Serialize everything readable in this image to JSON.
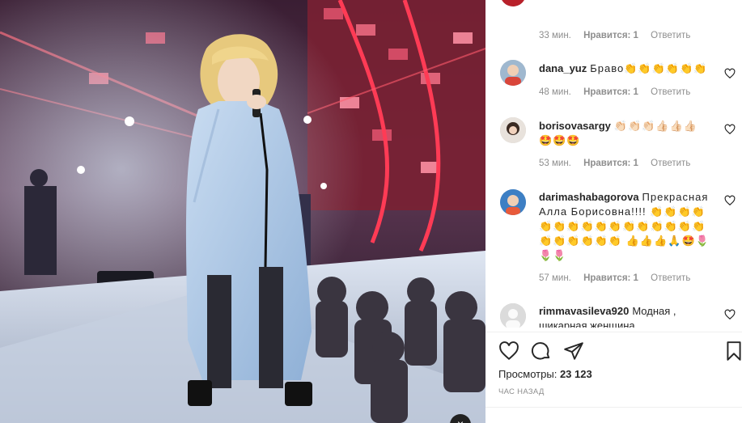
{
  "media": {
    "close_label": "×"
  },
  "comments": [
    {
      "id": "c0",
      "username": "",
      "text": "",
      "time": "33 мин.",
      "likes": "Нравится: 1",
      "reply": "Ответить"
    },
    {
      "id": "c1",
      "username": "dana_yuz",
      "text": "Браво👏👏👏👏👏👏",
      "time": "48 мин.",
      "likes": "Нравится: 1",
      "reply": "Ответить"
    },
    {
      "id": "c2",
      "username": "borisovasargy",
      "text": "👏🏻👏🏻👏🏻👍🏻👍🏻👍🏻 🤩🤩🤩",
      "time": "53 мин.",
      "likes": "Нравится: 1",
      "reply": "Ответить"
    },
    {
      "id": "c3",
      "username": "darimashabagorova",
      "text": "Прекрасная Алла Борисовна!!!! 👏👏👏👏👏👏👏👏👏👏👏👏👏👏👏👏👏👏👏👏👏👏 👍👍👍🙏🤩🌷🌷🌷",
      "time": "57 мин.",
      "likes": "Нравится: 1",
      "reply": "Ответить"
    },
    {
      "id": "c4",
      "username": "rimmavasileva920",
      "text": "Модная , шикарная женщина",
      "time": "",
      "likes": "",
      "reply": ""
    }
  ],
  "stats": {
    "views_label": "Просмотры:",
    "views_value": "23 123",
    "time_ago": "ЧАС НАЗАД"
  },
  "icons": {
    "like": "heart-icon",
    "comment": "comment-icon",
    "share": "share-icon",
    "save": "bookmark-icon"
  }
}
